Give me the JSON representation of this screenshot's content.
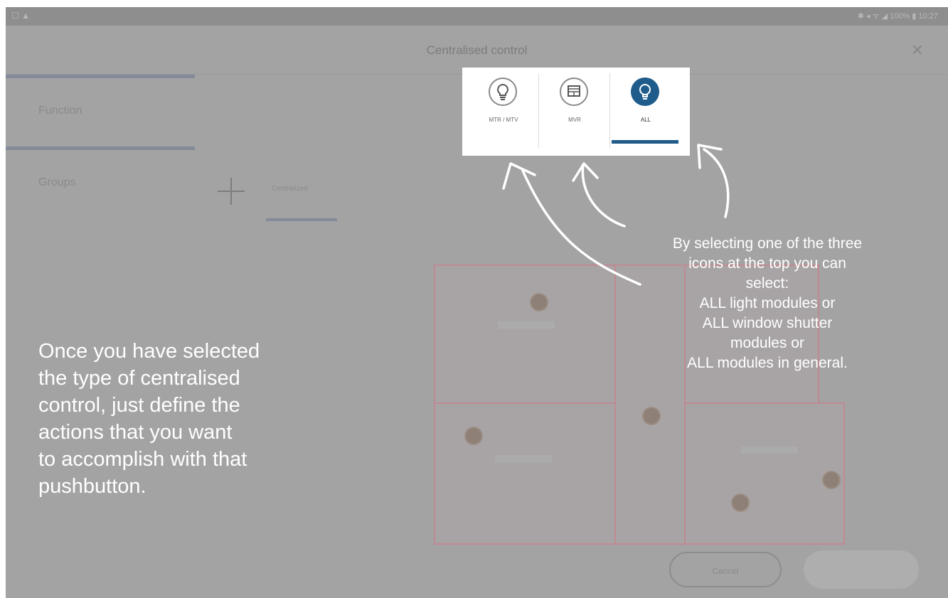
{
  "header": {
    "title": "Centralised control",
    "close_glyph": "✕"
  },
  "status": {
    "left": "☐ ▲",
    "right": "✱ ◂ ᯤ ◢ 100% ▮ 10:27"
  },
  "sidebar": {
    "items": [
      {
        "label": "Function"
      },
      {
        "label": "Groups"
      }
    ]
  },
  "groups": {
    "tab_label": "Centralized"
  },
  "popup": {
    "tabs": [
      {
        "label": "MTR / MTV",
        "icon": "lightbulb-icon",
        "selected": false
      },
      {
        "label": "MVR",
        "icon": "window-shutter-icon",
        "selected": false
      },
      {
        "label": "ALL",
        "icon": "all-modules-icon",
        "selected": true
      }
    ]
  },
  "footer": {
    "cancel_label": "Cancel",
    "confirm_label": ""
  },
  "callouts": {
    "right": [
      "By selecting one of the three",
      "icons at the top you can",
      "select:",
      "ALL light modules or",
      "ALL window shutter",
      "modules or",
      "ALL modules in general."
    ],
    "left": [
      "Once you have selected",
      "the type of centralised",
      "control, just define the",
      "actions that you want",
      "to accomplish with that",
      "pushbutton."
    ]
  },
  "colors": {
    "accent": "#1f5c8b",
    "overlay": "#a3a3a3",
    "callout_text": "#ffffff",
    "floorplan_border": "#c08a92"
  }
}
